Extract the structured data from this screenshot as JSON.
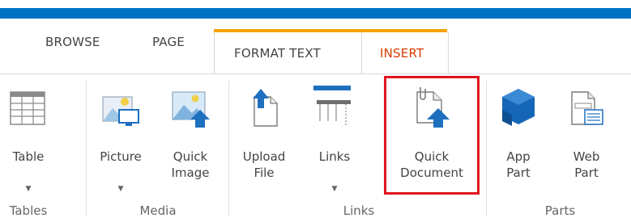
{
  "tabs": {
    "browse": "BROWSE",
    "page": "PAGE",
    "format_text": "FORMAT TEXT",
    "insert": "INSERT"
  },
  "buttons": {
    "table": {
      "label": "Table",
      "icon": "table-icon"
    },
    "picture": {
      "label": "Picture",
      "icon": "picture-icon"
    },
    "quick_image": {
      "line1": "Quick",
      "line2": "Image",
      "icon": "quick-image-icon"
    },
    "upload_file": {
      "line1": "Upload",
      "line2": "File",
      "icon": "upload-file-icon"
    },
    "links": {
      "label": "Links",
      "icon": "links-icon"
    },
    "quick_document": {
      "line1": "Quick",
      "line2": "Document",
      "icon": "quick-document-icon"
    },
    "app_part": {
      "line1": "App",
      "line2": "Part",
      "icon": "app-part-icon"
    },
    "web_part": {
      "line1": "Web",
      "line2": "Part",
      "icon": "web-part-icon"
    }
  },
  "groups": {
    "tables": "Tables",
    "media": "Media",
    "links": "Links",
    "parts": "Parts"
  },
  "colors": {
    "suite_bar": "#0072c6",
    "contextual_tab": "#f7a100",
    "active_tab_text": "#d83b01",
    "highlight": "#e0141e"
  }
}
